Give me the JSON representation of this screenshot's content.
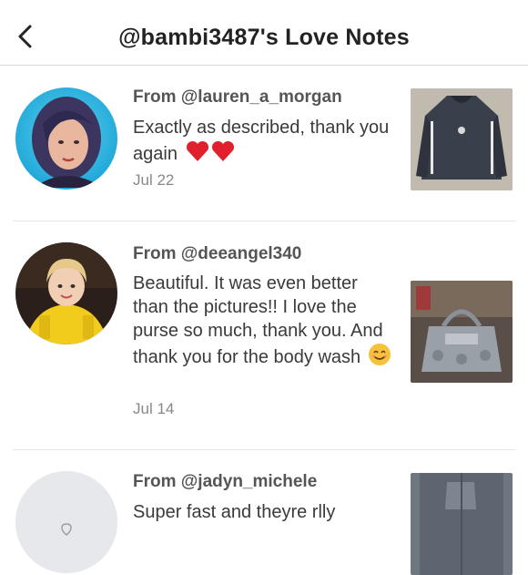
{
  "header": {
    "title": "@bambi3487's Love Notes",
    "back_icon": "chevron-left-icon"
  },
  "notes": [
    {
      "from": "From @lauren_a_morgan",
      "message": "Exactly as described, thank you again",
      "emoji": "❤️❤️",
      "date": "Jul 22"
    },
    {
      "from": "From @deeangel340",
      "message": "Beautiful. It was even better than the pictures!! I love the purse so much, thank you. And thank you for the body wash",
      "emoji": "😊",
      "date": "Jul 14"
    },
    {
      "from": "From @jadyn_michele",
      "message": "Super fast and theyre rlly",
      "emoji": "",
      "date": ""
    }
  ],
  "colors": {
    "emoji_red": "#e0202c",
    "emoji_yellow": "#f5c23a",
    "avatar_placeholder": "#e6e8ec"
  }
}
